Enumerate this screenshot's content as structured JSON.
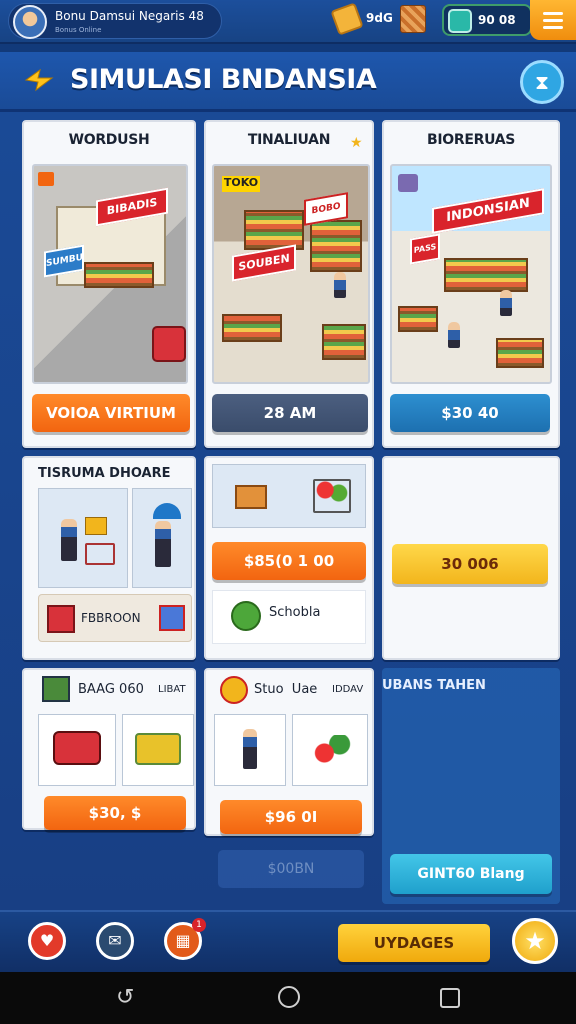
{
  "header": {
    "player_name": "Bonu Damsui Negaris 48",
    "player_subtitle": "Bonus Online",
    "gold": "9dG",
    "gems": "90 08"
  },
  "title": "SIMULASI BNDANSIA",
  "cards": {
    "warung": {
      "title": "WORDUSH",
      "scene_sign": "BIBADIS",
      "scene_sign2": "SUMBU",
      "button": "VOIOA VIRTIUM"
    },
    "toko": {
      "title": "TINALIUAN",
      "badge": "TOKO",
      "scene_sign": "SOUBEN",
      "scene_sign2": "BOBO",
      "button": "28 AM"
    },
    "market": {
      "title": "BIORERUAS",
      "scene_sign": "INDONSIAN",
      "scene_sign2": "PASS",
      "button": "$30 40"
    },
    "staff": {
      "title": "TISRUMA DHOARE",
      "item_label": "FBBROON"
    },
    "cart": {
      "button": "$85(0 1 00",
      "item_label": "Schobla"
    },
    "offer": {
      "button": "30 006"
    },
    "vehicle": {
      "title": "BAAG 060",
      "tag": "LIBAT",
      "button": "$30, $"
    },
    "garden": {
      "title": "Stuo  Uae",
      "tag": "IDDAV",
      "button": "$96 0I"
    },
    "empty": {
      "title": "UBANS TAHEN",
      "button": "GINT60 Blang",
      "ghost_value": "$00BN"
    }
  },
  "bottom": {
    "upgrade": "UYDAGES",
    "notif_count": "1"
  },
  "colors": {
    "accent_orange": "#f26510",
    "brand_blue": "#1a4a96",
    "gold": "#f2b51c",
    "teal": "#1fa0cc"
  },
  "icons": [
    "gold-icon",
    "gift-box-icon",
    "gem-icon",
    "menu-icon",
    "bolt-icon",
    "hourglass-icon",
    "star-icon",
    "back-icon",
    "home-icon",
    "recents-icon"
  ]
}
